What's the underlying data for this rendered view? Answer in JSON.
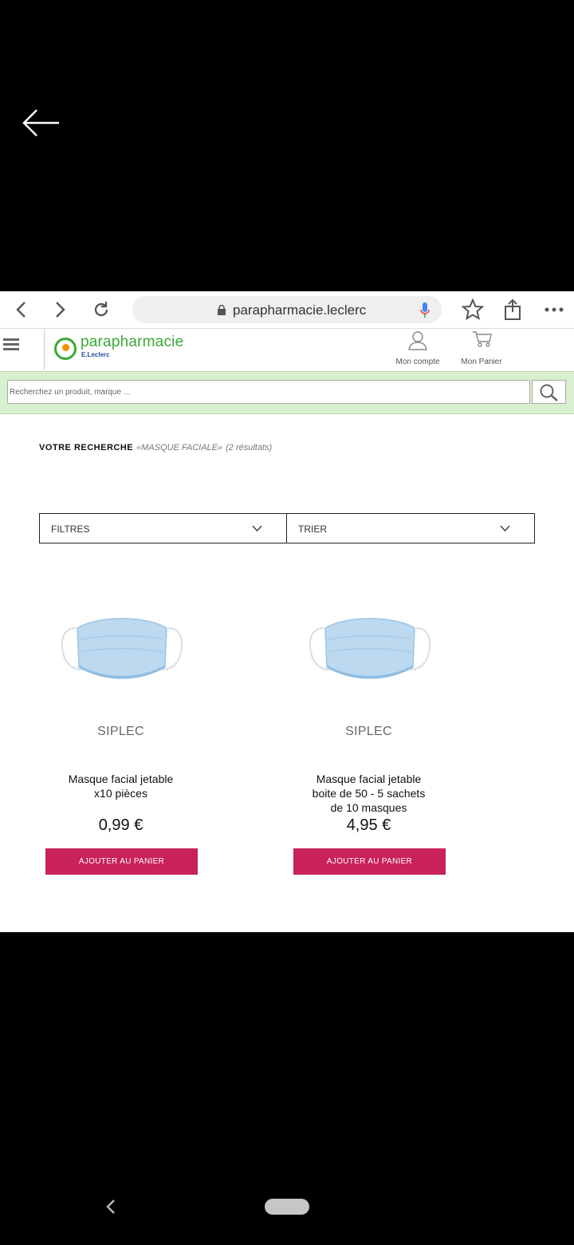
{
  "browser": {
    "url": "parapharmacie.leclerc"
  },
  "site": {
    "logo_word": "parapharmacie",
    "logo_sub": "E.Leclerc",
    "account_label": "Mon compte",
    "cart_label": "Mon Panier"
  },
  "search": {
    "placeholder": "Recherchez un produit, marque ..."
  },
  "results": {
    "label": "VOTRE RECHERCHE",
    "query": "«MASQUE FACIALE»",
    "count": "(2 résultats)"
  },
  "filters": {
    "filter_label": "FILTRES",
    "sort_label": "TRIER"
  },
  "products": [
    {
      "brand": "SIPLEC",
      "name": "Masque facial jetable\nx10 pièces",
      "price": "0,99 €",
      "button": "AJOUTER AU PANIER"
    },
    {
      "brand": "SIPLEC",
      "name": "Masque facial jetable\nboite de 50 - 5 sachets\nde 10 masques",
      "price": "4,95 €",
      "button": "AJOUTER AU PANIER"
    }
  ],
  "colors": {
    "brand_green": "#3aa935",
    "search_band": "#d9f0cf",
    "cart_button": "#c9215b"
  }
}
